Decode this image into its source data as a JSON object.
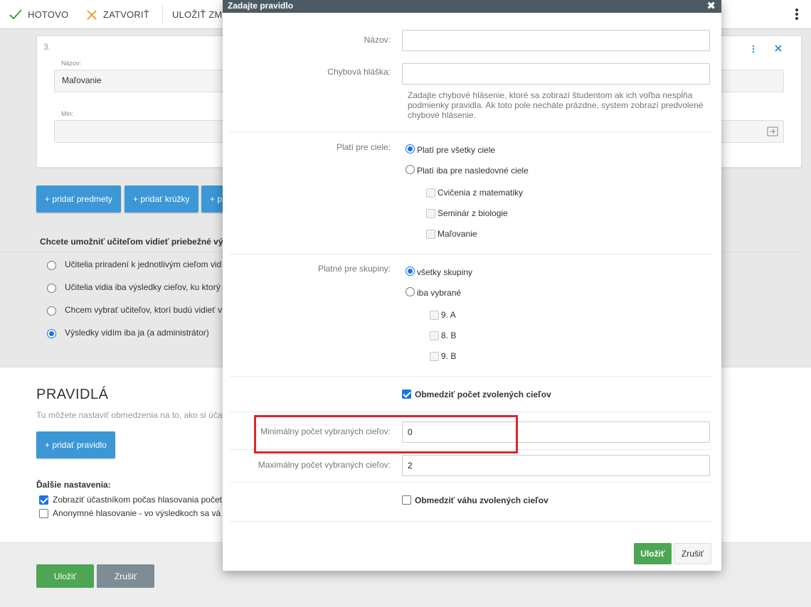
{
  "toolbar": {
    "done_label": "HOTOVO",
    "close_label": "ZATVORIŤ",
    "save_label": "ULOŽIŤ ZMENY",
    "done_color": "#3da64a",
    "close_color": "#f0a030"
  },
  "card": {
    "number": "3.",
    "name_label": "Názov:",
    "name_value": "Maľovanie",
    "min_label": "Min:"
  },
  "add_buttons": [
    "+ pridať predmety",
    "+ pridať krúžky",
    "+ p"
  ],
  "teachers": {
    "question": "Chcete umožniť učiteľom vidieť priebežné vý",
    "options": [
      {
        "label": "Učitelia priradení k jednotlivým cieľom vid",
        "selected": false
      },
      {
        "label": "Učitelia vidia iba výsledky cieľov, ku ktorý",
        "selected": false
      },
      {
        "label": "Chcem vybrať učiteľov, ktorí budú vidieť v",
        "selected": false
      },
      {
        "label": "Výsledky vidím iba ja (a administrátor)",
        "selected": true
      }
    ]
  },
  "rules": {
    "heading": "PRAVIDLÁ",
    "desc": "Tu môžete nastaviť obmedzenia na to, ako si úča",
    "add_rule": "+ pridať pravidlo",
    "more_heading": "Ďalšie nastavenia:",
    "more_options": [
      {
        "label": "Zobraziť účastníkom počas hlasovania počet",
        "checked": true
      },
      {
        "label": "Anonymné hlasovanie - vo výsledkoch sa vá",
        "checked": false
      }
    ]
  },
  "footer": {
    "save": "Uložiť",
    "cancel": "Zrušiť"
  },
  "modal": {
    "title": "Zadajte pravidlo",
    "close_glyph": "✖",
    "name_label": "Názov:",
    "name_value": "",
    "error_label": "Chybová hláška:",
    "error_value": "",
    "error_help": "Zadajte chybové hlásenie, ktoré sa zobrazí študentom ak ich voľba nespĺňa podmienky pravidla. Ak toto pole necháte prázdne, system zobrazí predvolené chybové hlásenie.",
    "goals_label": "Platí pre ciele:",
    "goals_all": "Platí pre všetky ciele",
    "goals_only": "Platí iba pre nasledovné ciele",
    "goals_list": [
      "Cvičenia z matematiky",
      "Seminár z biologie",
      "Maľovanie"
    ],
    "groups_label": "Platné pre skupiny:",
    "groups_all": "všetky skupiny",
    "groups_only": "iba vybrané",
    "groups_list": [
      "9. A",
      "8. B",
      "9. B"
    ],
    "limit_count_label": "Obmedziť počet zvolených cieľov",
    "limit_count_checked": true,
    "min_label": "Minimálny počet vybraných cieľov:",
    "min_value": "0",
    "max_label": "Maximálny počet vybraných cieľov:",
    "max_value": "2",
    "limit_weight_label": "Obmedziť váhu zvolených cieľov",
    "limit_weight_checked": false,
    "save": "Uložiť",
    "cancel": "Zrušiť",
    "highlight_color": "#e0242c"
  }
}
